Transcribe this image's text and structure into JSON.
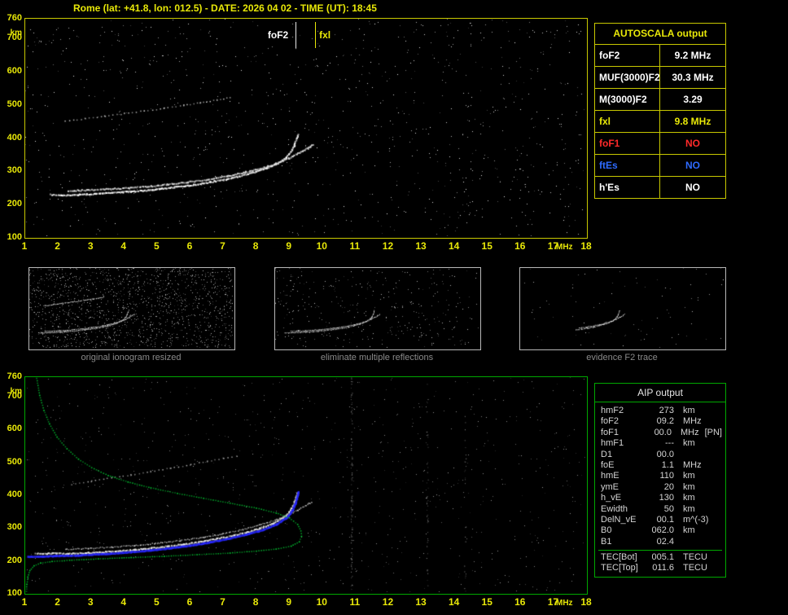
{
  "header": {
    "title": "Rome (lat: +41.8, lon: 012.5) - DATE: 2026 04 02 - TIME (UT): 18:45"
  },
  "autoscala": {
    "title": "AUTOSCALA output",
    "rows": [
      {
        "label": "foF2",
        "value": "9.2 MHz",
        "color": "#ffffff"
      },
      {
        "label": "MUF(3000)F2",
        "value": "30.3 MHz",
        "color": "#ffffff"
      },
      {
        "label": "M(3000)F2",
        "value": "3.29",
        "color": "#ffffff"
      },
      {
        "label": "fxl",
        "value": "9.8 MHz",
        "color": "#e8e808"
      },
      {
        "label": "foF1",
        "value": "NO",
        "color": "#ff2a2a"
      },
      {
        "label": "ftEs",
        "value": "NO",
        "color": "#2e6bff"
      },
      {
        "label": "h'Es",
        "value": "NO",
        "color": "#ffffff"
      }
    ]
  },
  "thumbnails": {
    "items": [
      {
        "caption": "original ionogram resized",
        "seed": 11,
        "noise_count": 1500,
        "show": [
          "F2-trace-ordinary",
          "F2-trace-extraordinary",
          "second-reflection"
        ]
      },
      {
        "caption": "eliminate multiple reflections",
        "seed": 22,
        "noise_count": 360,
        "show": [
          "F2-trace-ordinary",
          "F2-trace-extraordinary"
        ]
      },
      {
        "caption": "evidence F2 trace",
        "seed": 33,
        "noise_count": 80,
        "show": [
          "F2-trace-ordinary-steep",
          "F2-trace-extraordinary-steep"
        ]
      }
    ]
  },
  "aip": {
    "title": "AIP output",
    "rows": [
      {
        "label": "hmF2",
        "value": "273",
        "unit": "km"
      },
      {
        "label": "foF2",
        "value": "09.2",
        "unit": "MHz"
      },
      {
        "label": "foF1",
        "value": "00.0",
        "unit": "MHz",
        "note": "[PN]"
      },
      {
        "label": "hmF1",
        "value": "---",
        "unit": "km"
      },
      {
        "label": "D1",
        "value": "00.0",
        "unit": ""
      },
      {
        "label": "foE",
        "value": "1.1",
        "unit": "MHz"
      },
      {
        "label": "hmE",
        "value": "110",
        "unit": "km"
      },
      {
        "label": "ymE",
        "value": "20",
        "unit": "km"
      },
      {
        "label": "h_vE",
        "value": "130",
        "unit": "km"
      },
      {
        "label": "Ewidth",
        "value": "50",
        "unit": "km"
      },
      {
        "label": "DelN_vE",
        "value": "00.1",
        "unit": "m^(-3)"
      },
      {
        "label": "B0",
        "value": "062.0",
        "unit": "km"
      },
      {
        "label": "B1",
        "value": "02.4",
        "unit": ""
      }
    ],
    "tec_rows": [
      {
        "label": "TEC[Bot]",
        "value": "005.1",
        "unit": "TECU"
      },
      {
        "label": "TEC[Top]",
        "value": "011.6",
        "unit": "TECU"
      }
    ]
  },
  "chart_data": [
    {
      "id": "main_ionogram",
      "type": "scatter",
      "title": "recorded ionogram",
      "xlabel": "MHz",
      "ylabel": "km",
      "xlim": [
        1,
        18
      ],
      "ylim": [
        100,
        760
      ],
      "xticks": [
        1,
        2,
        3,
        4,
        5,
        6,
        7,
        8,
        9,
        10,
        11,
        12,
        13,
        14,
        15,
        16,
        17,
        18
      ],
      "yticks": [
        760,
        700,
        600,
        500,
        400,
        300,
        200,
        100
      ],
      "markers": {
        "foF2_MHz": 9.2,
        "foF2_label": "foF2",
        "fxI_MHz": 9.8,
        "fxI_label": "fxl"
      },
      "noise": {
        "seed": 20260402,
        "count": 1050,
        "color": "#e8e8e8",
        "bands": []
      },
      "series": [
        {
          "name": "F2-trace-ordinary",
          "color": "#ffffff",
          "dot": 2,
          "gap": 1.5,
          "jit": 1.4,
          "points": [
            [
              1.75,
              228
            ],
            [
              2.1,
              226
            ],
            [
              2.6,
              228
            ],
            [
              3.1,
              231
            ],
            [
              3.6,
              234
            ],
            [
              4.1,
              237
            ],
            [
              4.6,
              241
            ],
            [
              5.1,
              246
            ],
            [
              5.6,
              252
            ],
            [
              6.1,
              258
            ],
            [
              6.6,
              266
            ],
            [
              7.1,
              275
            ],
            [
              7.5,
              284
            ],
            [
              7.9,
              295
            ],
            [
              8.3,
              308
            ],
            [
              8.6,
              322
            ],
            [
              8.9,
              340
            ],
            [
              9.05,
              358
            ],
            [
              9.15,
              378
            ],
            [
              9.22,
              400
            ],
            [
              9.26,
              412
            ]
          ]
        },
        {
          "name": "F2-trace-extraordinary",
          "color": "#e4e4e4",
          "dot": 2,
          "gap": 1.8,
          "jit": 1.4,
          "points": [
            [
              2.3,
              240
            ],
            [
              2.9,
              242
            ],
            [
              3.5,
              245
            ],
            [
              4.1,
              248
            ],
            [
              4.7,
              253
            ],
            [
              5.3,
              259
            ],
            [
              5.9,
              266
            ],
            [
              6.5,
              274
            ],
            [
              7.1,
              284
            ],
            [
              7.6,
              295
            ],
            [
              8.1,
              307
            ],
            [
              8.6,
              322
            ],
            [
              9.0,
              339
            ],
            [
              9.3,
              355
            ],
            [
              9.55,
              369
            ],
            [
              9.72,
              381
            ]
          ]
        },
        {
          "name": "second-reflection",
          "color": "#c8c8c8",
          "dot": 1.5,
          "gap": 4.5,
          "jit": 1.2,
          "points": [
            [
              2.2,
              450
            ],
            [
              2.8,
              458
            ],
            [
              3.4,
              466
            ],
            [
              4.0,
              474
            ],
            [
              4.6,
              482
            ],
            [
              5.2,
              490
            ],
            [
              5.8,
              499
            ],
            [
              6.3,
              507
            ],
            [
              6.8,
              515
            ],
            [
              7.2,
              522
            ]
          ]
        }
      ]
    },
    {
      "id": "aip_ionogram",
      "type": "scatter",
      "title": "autoscaled ionogram with restored trace and electron density profile",
      "xlabel": "MHz",
      "ylabel": "km",
      "xlim": [
        1,
        18
      ],
      "ylim": [
        100,
        760
      ],
      "xticks": [
        1,
        2,
        3,
        4,
        5,
        6,
        7,
        8,
        9,
        10,
        11,
        12,
        13,
        14,
        15,
        16,
        17,
        18
      ],
      "yticks": [
        760,
        700,
        600,
        500,
        400,
        300,
        200,
        100
      ],
      "noise": {
        "seed": 184500,
        "count": 850,
        "color": "#9a9a9a",
        "bands": [
          {
            "f": 10.9,
            "count": 110
          },
          {
            "f": 13.2,
            "count": 45
          },
          {
            "f": 14.35,
            "count": 26
          }
        ]
      },
      "series": [
        {
          "name": "F2-trace-ordinary",
          "color": "#f0f0f0",
          "dot": 2,
          "gap": 1.5,
          "jit": 1.4,
          "points": [
            [
              1.3,
              220
            ],
            [
              1.8,
              221
            ],
            [
              2.3,
              220
            ],
            [
              2.8,
              222
            ],
            [
              3.3,
              225
            ],
            [
              3.8,
              228
            ],
            [
              4.3,
              232
            ],
            [
              4.8,
              237
            ],
            [
              5.3,
              243
            ],
            [
              5.8,
              249
            ],
            [
              6.3,
              257
            ],
            [
              6.8,
              266
            ],
            [
              7.3,
              276
            ],
            [
              7.7,
              286
            ],
            [
              8.1,
              298
            ],
            [
              8.5,
              313
            ],
            [
              8.8,
              330
            ],
            [
              9.0,
              348
            ],
            [
              9.12,
              368
            ],
            [
              9.2,
              390
            ],
            [
              9.25,
              408
            ]
          ]
        },
        {
          "name": "F2-trace-extraordinary",
          "color": "#d8d8d8",
          "dot": 1.5,
          "gap": 2.2,
          "jit": 1.2,
          "points": [
            [
              2.2,
              233
            ],
            [
              2.9,
              236
            ],
            [
              3.6,
              240
            ],
            [
              4.3,
              245
            ],
            [
              5.0,
              252
            ],
            [
              5.7,
              260
            ],
            [
              6.4,
              270
            ],
            [
              7.0,
              281
            ],
            [
              7.6,
              294
            ],
            [
              8.1,
              308
            ],
            [
              8.6,
              324
            ],
            [
              9.0,
              340
            ],
            [
              9.25,
              354
            ],
            [
              9.5,
              367
            ],
            [
              9.68,
              378
            ]
          ]
        },
        {
          "name": "second-reflection",
          "color": "#b4b4b4",
          "dot": 1.5,
          "gap": 5,
          "jit": 1.2,
          "points": [
            [
              2.4,
              432
            ],
            [
              3.0,
              442
            ],
            [
              3.6,
              452
            ],
            [
              4.2,
              462
            ],
            [
              4.8,
              472
            ],
            [
              5.4,
              482
            ],
            [
              6.0,
              493
            ],
            [
              6.5,
              503
            ],
            [
              7.0,
              512
            ],
            [
              7.4,
              520
            ]
          ]
        },
        {
          "name": "autoscala-restored-trace",
          "color": "#2828ff",
          "dot": 2.5,
          "gap": 1.2,
          "jit": 0.8,
          "points": [
            [
              1.05,
              211
            ],
            [
              1.5,
              212
            ],
            [
              1.9,
              214
            ],
            [
              2.5,
              215
            ],
            [
              3.0,
              218
            ],
            [
              3.6,
              221
            ],
            [
              4.2,
              226
            ],
            [
              4.8,
              231
            ],
            [
              5.4,
              238
            ],
            [
              6.0,
              246
            ],
            [
              6.6,
              256
            ],
            [
              7.2,
              268
            ],
            [
              7.7,
              280
            ],
            [
              8.2,
              294
            ],
            [
              8.6,
              311
            ],
            [
              8.9,
              330
            ],
            [
              9.05,
              348
            ],
            [
              9.15,
              368
            ],
            [
              9.22,
              390
            ],
            [
              9.27,
              410
            ]
          ]
        },
        {
          "name": "electron-density-profile",
          "color": "#00c832",
          "dot": 1.5,
          "gap": 3,
          "jit": 0.3,
          "points": [
            [
              1.33,
              758
            ],
            [
              1.42,
              706
            ],
            [
              1.55,
              660
            ],
            [
              1.72,
              618
            ],
            [
              1.95,
              578
            ],
            [
              2.25,
              542
            ],
            [
              2.6,
              510
            ],
            [
              3.0,
              484
            ],
            [
              3.5,
              460
            ],
            [
              4.1,
              440
            ],
            [
              4.8,
              422
            ],
            [
              5.6,
              405
            ],
            [
              6.4,
              390
            ],
            [
              7.2,
              375
            ],
            [
              8.0,
              360
            ],
            [
              8.6,
              345
            ],
            [
              9.0,
              330
            ],
            [
              9.25,
              310
            ],
            [
              9.35,
              290
            ],
            [
              9.37,
              273
            ],
            [
              9.3,
              256
            ],
            [
              9.05,
              243
            ],
            [
              8.6,
              234
            ],
            [
              8.0,
              228
            ],
            [
              7.2,
              222
            ],
            [
              6.2,
              217
            ],
            [
              5.2,
              212
            ],
            [
              4.2,
              208
            ],
            [
              3.2,
              204
            ],
            [
              2.4,
              200
            ],
            [
              1.8,
              196
            ],
            [
              1.45,
              191
            ],
            [
              1.25,
              183
            ],
            [
              1.12,
              168
            ],
            [
              1.06,
              148
            ],
            [
              1.03,
              126
            ],
            [
              1.02,
              104
            ]
          ]
        }
      ]
    }
  ]
}
